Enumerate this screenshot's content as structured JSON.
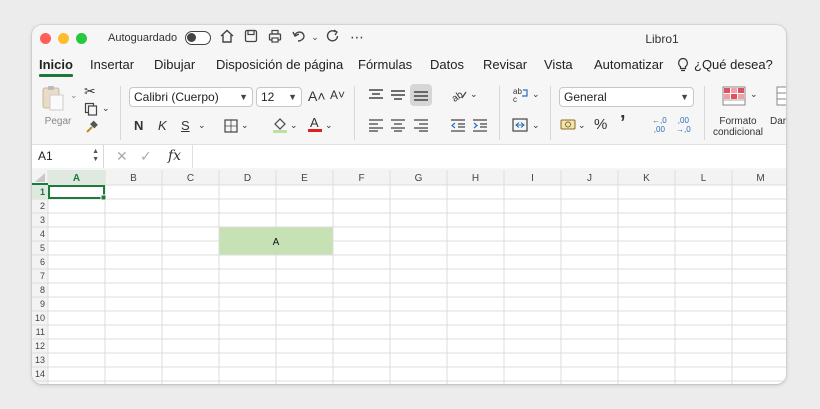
{
  "titlebar": {
    "autosave_label": "Autoguardado",
    "doc_title": "Libro1",
    "more_label": "⋯"
  },
  "tabs": [
    {
      "label": "Inicio",
      "active": true
    },
    {
      "label": "Insertar"
    },
    {
      "label": "Dibujar"
    },
    {
      "label": "Disposición de página"
    },
    {
      "label": "Fórmulas"
    },
    {
      "label": "Datos"
    },
    {
      "label": "Revisar"
    },
    {
      "label": "Vista"
    },
    {
      "label": "Automatizar"
    }
  ],
  "tell_me": "¿Qué desea?",
  "ribbon": {
    "paste_label": "Pegar",
    "font_name": "Calibri (Cuerpo)",
    "font_size": "12",
    "grow_font": "A˄",
    "shrink_font": "A˅",
    "bold": "N",
    "italic": "K",
    "underline": "S",
    "number_format": "General",
    "percent": "%",
    "comma": "’",
    "inc_decimal": "←,0\n,00",
    "dec_decimal": ",00\n→,0",
    "cond_format_label": "Formato condicional",
    "next_group_label": "Dar for como t"
  },
  "formula_bar": {
    "cell_ref": "A1",
    "cancel": "✕",
    "enter": "✓",
    "fx": "fx",
    "value": ""
  },
  "sheet": {
    "columns": [
      "A",
      "B",
      "C",
      "D",
      "E",
      "F",
      "G",
      "H",
      "I",
      "J",
      "K",
      "L",
      "M"
    ],
    "rows": [
      "1",
      "2",
      "3",
      "4",
      "5",
      "6",
      "7",
      "8",
      "9",
      "10",
      "11",
      "12",
      "13",
      "14"
    ],
    "selected_cell": "A1",
    "merged_cell": {
      "range": "D4:E5",
      "value": "A",
      "fill": "#c6e2b4"
    },
    "accent": "#1e7a3c"
  }
}
